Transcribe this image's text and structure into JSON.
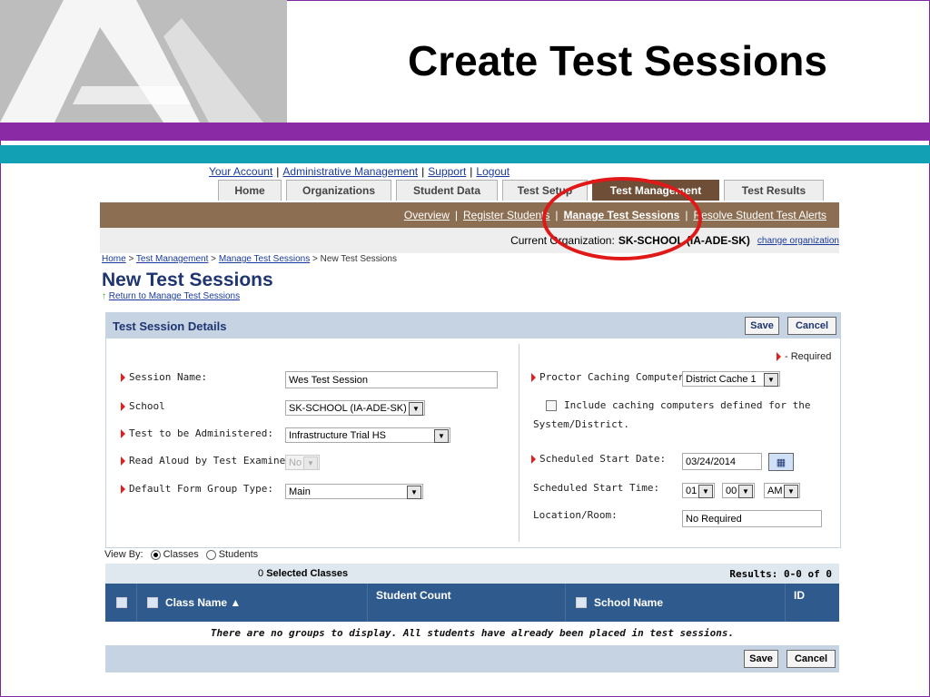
{
  "slide": {
    "title": "Create Test Sessions",
    "accent": "#8b2aa5",
    "teal": "#12a0b4",
    "highlight_color": "#e01818"
  },
  "top_links": [
    "Your Account",
    "Administrative Management",
    "Support",
    "Logout"
  ],
  "tabs": [
    {
      "label": "Home",
      "active": false
    },
    {
      "label": "Organizations",
      "active": false
    },
    {
      "label": "Student Data",
      "active": false
    },
    {
      "label": "Test Setup",
      "active": false
    },
    {
      "label": "Test Management",
      "active": true
    },
    {
      "label": "Test Results",
      "active": false
    }
  ],
  "subnav": [
    "Overview",
    "Register Students",
    "Manage Test Sessions",
    "Resolve Student Test Alerts"
  ],
  "org_bar": {
    "label": "Current Organization:",
    "value": "SK-SCHOOL (IA-ADE-SK)",
    "change_link": "change organization"
  },
  "breadcrumb": {
    "home": "Home",
    "test_management": "Test Management",
    "manage": "Manage Test Sessions",
    "current": "New Test Sessions"
  },
  "page": {
    "title": "New Test Sessions",
    "return_link": "Return to Manage Test Sessions"
  },
  "details": {
    "header": "Test Session Details",
    "save": "Save",
    "cancel": "Cancel",
    "required_note": "- Required",
    "session_name_label": "Session Name:",
    "session_name_value": "Wes Test Session",
    "school_label": "School",
    "school_value": "SK-SCHOOL (IA-ADE-SK)",
    "test_label": "Test to be Administered:",
    "test_value": "Infrastructure Trial HS",
    "read_aloud_label": "Read Aloud by Test Examiner:",
    "read_aloud_value": "No",
    "form_group_label": "Default Form Group Type:",
    "form_group_value": "Main",
    "proctor_label": "Proctor Caching Computer:",
    "proctor_value": "District Cache 1",
    "include_caching_label": "Include caching computers defined for the",
    "include_caching_label2": "System/District.",
    "start_date_label": "Scheduled Start Date:",
    "start_date_value": "03/24/2014",
    "start_time_label": "Scheduled Start Time:",
    "hour": "01",
    "minute": "00",
    "ampm": "AM",
    "location_label": "Location/Room:",
    "location_value": "No Required"
  },
  "view_by": {
    "label": "View By:",
    "classes": "Classes",
    "students": "Students"
  },
  "results": {
    "selected_count": "0",
    "selected_label": "Selected Classes",
    "results_text": "Results: 0-0 of 0"
  },
  "table": {
    "columns": [
      "Class Name",
      "Student Count",
      "School Name",
      "ID"
    ],
    "empty_message": "There are no groups to display. All students have already been placed in test sessions."
  },
  "footer": {
    "save": "Save",
    "cancel": "Cancel"
  }
}
